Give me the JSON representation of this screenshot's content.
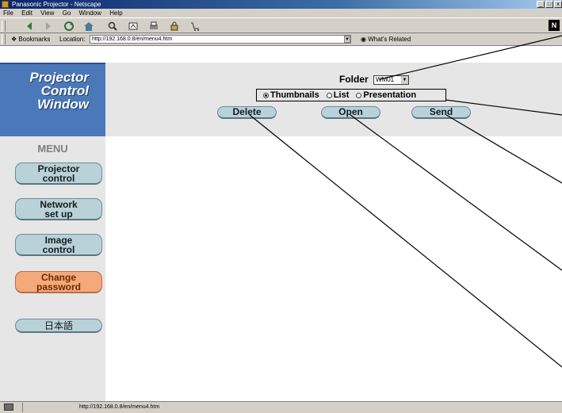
{
  "window": {
    "title": "Panasonic Projector - Netscape",
    "controls": [
      "_",
      "□",
      "x"
    ]
  },
  "menubar": [
    "File",
    "Edit",
    "View",
    "Go",
    "Window",
    "Help"
  ],
  "location_bar": {
    "bookmarks_label": "Bookmarks",
    "location_label": "Location:",
    "url": "http://192.168.0.8/en/menu4.htm",
    "whats_related": "What's Related"
  },
  "logo": {
    "line1": "Projector",
    "line2": "Control",
    "line3": "Window"
  },
  "sidebar": {
    "menu_title": "MENU",
    "items": [
      {
        "label": "Projector\ncontrol"
      },
      {
        "label": "Network\nset up"
      },
      {
        "label": "Image\ncontrol"
      },
      {
        "label": "Change\npassword",
        "active": true
      },
      {
        "label": "日本語"
      }
    ]
  },
  "header": {
    "folder_label": "Folder",
    "folder_value": "WM01",
    "modes": [
      {
        "label": "Thumbnails",
        "selected": true
      },
      {
        "label": "List",
        "selected": false
      },
      {
        "label": "Presentation",
        "selected": false
      }
    ],
    "buttons": {
      "delete": "Delete",
      "open": "Open",
      "send": "Send"
    }
  },
  "statusbar": {
    "text": "http://192.168.0.8/en/menu4.htm"
  },
  "colors": {
    "logo_bg": "#4a78b8",
    "button_bg": "#b9d2d9",
    "active_button_bg": "#f5a97a",
    "panel_bg": "#e6e6e6"
  }
}
